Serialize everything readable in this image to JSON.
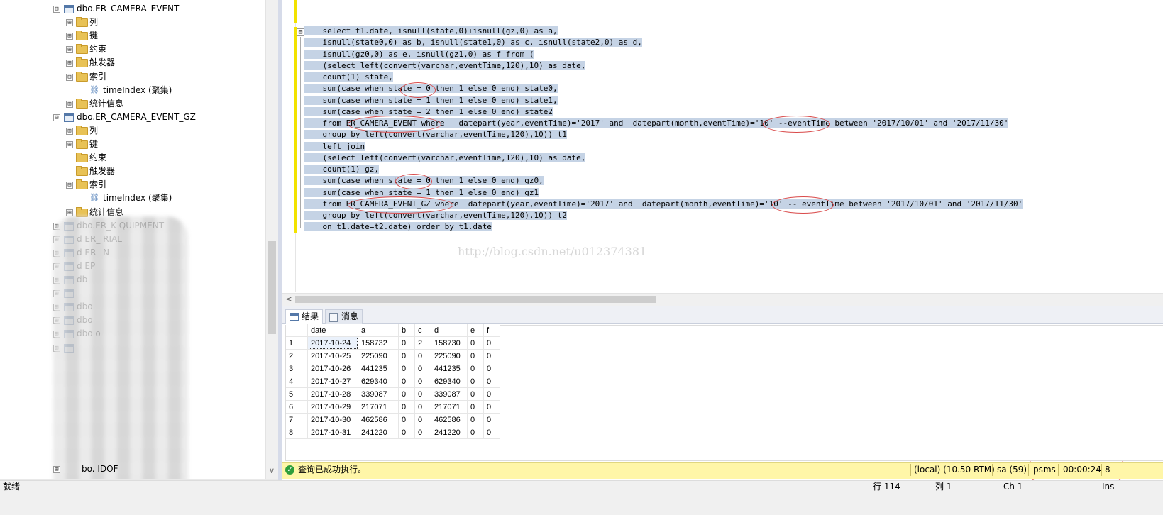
{
  "explorer": {
    "rows": [
      {
        "type": "table",
        "label": "dbo.ER_CAMERA_EVENT",
        "expander": "⊟"
      },
      {
        "type": "folder",
        "label": "列",
        "expander": "⊞"
      },
      {
        "type": "folder",
        "label": "键",
        "expander": "⊞"
      },
      {
        "type": "folder",
        "label": "约束",
        "expander": "⊞"
      },
      {
        "type": "folder",
        "label": "触发器",
        "expander": "⊞"
      },
      {
        "type": "folder",
        "label": "索引",
        "expander": "⊟"
      },
      {
        "type": "index",
        "label": "timeIndex (聚集)",
        "expander": ""
      },
      {
        "type": "folder",
        "label": "统计信息",
        "expander": "⊞"
      },
      {
        "type": "table",
        "label": "dbo.ER_CAMERA_EVENT_GZ",
        "expander": "⊟"
      },
      {
        "type": "folder",
        "label": "列",
        "expander": "⊞"
      },
      {
        "type": "folder",
        "label": "键",
        "expander": "⊞"
      },
      {
        "type": "folder",
        "label": "约束",
        "expander": ""
      },
      {
        "type": "folder",
        "label": "触发器",
        "expander": ""
      },
      {
        "type": "folder",
        "label": "索引",
        "expander": "⊟"
      },
      {
        "type": "index",
        "label": "timeIndex (聚集)",
        "expander": ""
      },
      {
        "type": "folder",
        "label": "统计信息",
        "expander": "⊞"
      },
      {
        "type": "table",
        "label": "dbo.ER_K     QUIPMENT",
        "expander": "⊞"
      },
      {
        "type": "table",
        "label": "d    ER_      RIAL",
        "expander": "⊞"
      },
      {
        "type": "table",
        "label": "d    ER_      N",
        "expander": "⊞"
      },
      {
        "type": "table",
        "label": "d    EP",
        "expander": "⊞"
      },
      {
        "type": "table",
        "label": "db",
        "expander": "⊞"
      },
      {
        "type": "table",
        "label": "",
        "expander": "⊞"
      },
      {
        "type": "table",
        "label": "dbo",
        "expander": "⊞"
      },
      {
        "type": "table",
        "label": "dbo",
        "expander": "⊞"
      },
      {
        "type": "table",
        "label": "dbo                    o",
        "expander": "⊞"
      },
      {
        "type": "table",
        "label": "",
        "expander": "⊞"
      }
    ],
    "last_row_label": "bo.     IDOF"
  },
  "editor": {
    "collapse_glyph": "⊟",
    "lines": [
      "    select t1.date, isnull(state,0)+isnull(gz,0) as a,",
      "    isnull(state0,0) as b, isnull(state1,0) as c, isnull(state2,0) as d,",
      "    isnull(gz0,0) as e, isnull(gz1,0) as f from (",
      "    (select left(convert(varchar,eventTime,120),10) as date,",
      "    count(1) state,",
      "    sum(case when state = 0 then 1 else 0 end) state0,",
      "    sum(case when state = 1 then 1 else 0 end) state1,",
      "    sum(case when state = 2 then 1 else 0 end) state2",
      "    from ER_CAMERA_EVENT where   datepart(year,eventTime)='2017' and  datepart(month,eventTime)='10' --eventTime between '2017/10/01' and '2017/11/30'",
      "    group by left(convert(varchar,eventTime,120),10)) t1",
      "    left join",
      "    (select left(convert(varchar,eventTime,120),10) as date,",
      "    count(1) gz,",
      "    sum(case when state = 0 then 1 else 0 end) gz0,",
      "    sum(case when state = 1 then 1 else 0 end) gz1",
      "    from ER_CAMERA_EVENT_GZ where  datepart(year,eventTime)='2017' and  datepart(month,eventTime)='10' -- eventTime between '2017/10/01' and '2017/11/30'",
      "    group by left(convert(varchar,eventTime,120),10)) t2",
      "    on t1.date=t2.date) order by t1.date"
    ],
    "watermark": "http://blog.csdn.net/u012374381"
  },
  "results": {
    "tabs": [
      {
        "label": "结果"
      },
      {
        "label": "消息"
      }
    ],
    "columns": [
      "date",
      "a",
      "b",
      "c",
      "d",
      "e",
      "f"
    ],
    "rows": [
      [
        "1",
        "2017-10-24",
        "158732",
        "0",
        "2",
        "158730",
        "0",
        "0"
      ],
      [
        "2",
        "2017-10-25",
        "225090",
        "0",
        "0",
        "225090",
        "0",
        "0"
      ],
      [
        "3",
        "2017-10-26",
        "441235",
        "0",
        "0",
        "441235",
        "0",
        "0"
      ],
      [
        "4",
        "2017-10-27",
        "629340",
        "0",
        "0",
        "629340",
        "0",
        "0"
      ],
      [
        "5",
        "2017-10-28",
        "339087",
        "0",
        "0",
        "339087",
        "0",
        "0"
      ],
      [
        "6",
        "2017-10-29",
        "217071",
        "0",
        "0",
        "217071",
        "0",
        "0"
      ],
      [
        "7",
        "2017-10-30",
        "462586",
        "0",
        "0",
        "462586",
        "0",
        "0"
      ],
      [
        "8",
        "2017-10-31",
        "241220",
        "0",
        "0",
        "241220",
        "0",
        "0"
      ]
    ]
  },
  "query_status": {
    "message": "查询已成功执行。",
    "server": "(local) (10.50 RTM)",
    "user": "sa (59)",
    "database": "psms",
    "elapsed": "00:00:24",
    "rows": "8"
  },
  "app_status": {
    "ready": "就绪",
    "line": "行 114",
    "col": "列 1",
    "ch": "Ch 1",
    "mode": "Ins"
  },
  "colors": {
    "selection": "#c5d3e5",
    "status_bar": "#fff6a8",
    "annotation": "#d94a4a"
  }
}
